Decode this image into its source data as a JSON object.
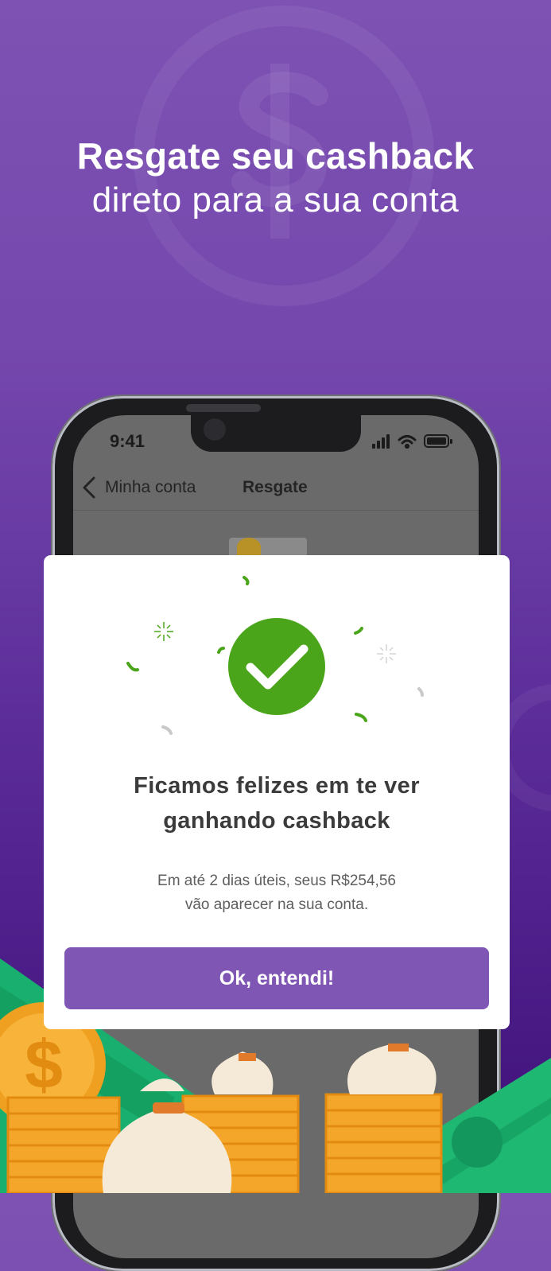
{
  "headline": {
    "line1": "Resgate seu cashback",
    "line2": "direto para a sua conta"
  },
  "phone": {
    "status_time": "9:41",
    "nav_back_label": "Minha conta",
    "nav_title": "Resgate"
  },
  "modal": {
    "title_line1": "Ficamos felizes em te ver",
    "title_line2": "ganhando cashback",
    "body_line1": "Em até 2 dias úteis, seus R$254,56",
    "body_line2": "vão aparecer na sua conta.",
    "button_label": "Ok, entendi!"
  },
  "colors": {
    "background_top": "#7e52b3",
    "background_bottom": "#3e0f78",
    "accent_purple": "#7f56b4",
    "success_green": "#4aa51a",
    "money_green": "#1fb873",
    "coin_orange": "#f5a623"
  },
  "icons": [
    "dollar-sign-icon",
    "chevron-left-icon",
    "signal-icon",
    "wifi-icon",
    "battery-icon",
    "check-icon",
    "sparkle-icon",
    "confetti-icon",
    "coin-icon",
    "money-bag-icon",
    "banknote-icon"
  ]
}
